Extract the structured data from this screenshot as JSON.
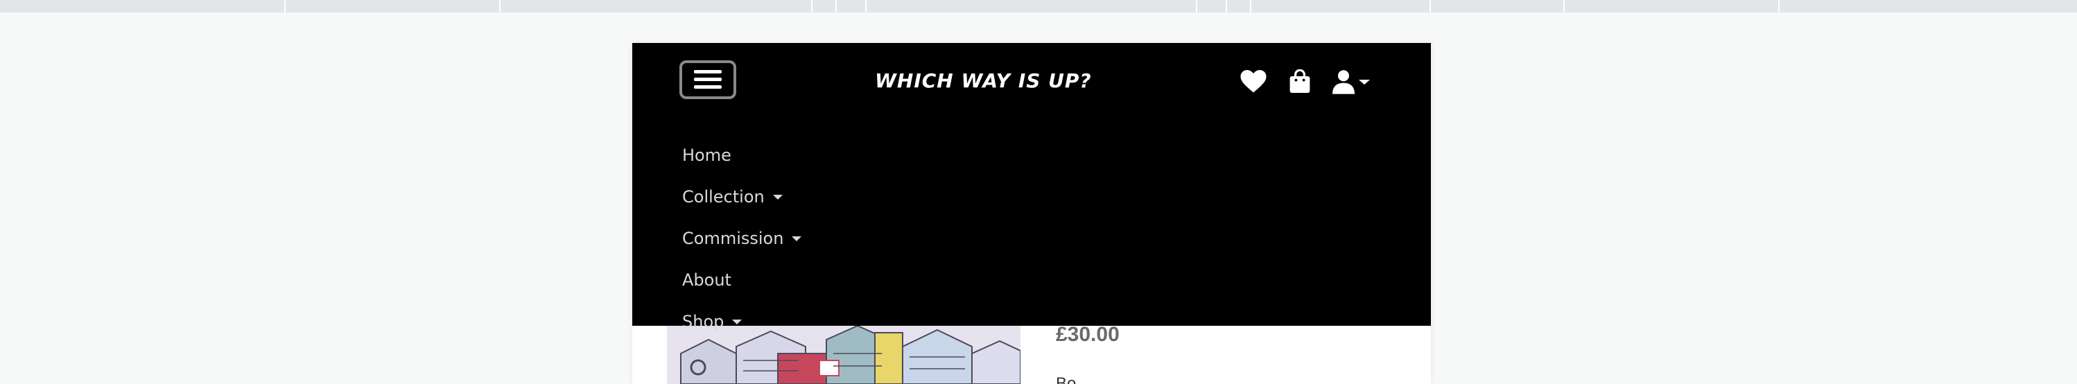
{
  "navbar": {
    "brand": "WHICH WAY IS UP?",
    "menu": [
      {
        "label": "Home",
        "has_dropdown": false
      },
      {
        "label": "Collection",
        "has_dropdown": true
      },
      {
        "label": "Commission",
        "has_dropdown": true
      },
      {
        "label": "About",
        "has_dropdown": false
      },
      {
        "label": "Shop",
        "has_dropdown": true
      }
    ],
    "icons": [
      "hamburger-menu-icon",
      "heart-icon",
      "shopping-bag-icon",
      "user-icon",
      "chevron-down-icon"
    ]
  },
  "product": {
    "price": "£30.00",
    "subline": "Bo"
  },
  "colors": {
    "navbar_bg": "#000000",
    "menu_text": "#d9d9d9",
    "page_bg": "#f7f8f8",
    "price_text": "#6a6a6a"
  }
}
